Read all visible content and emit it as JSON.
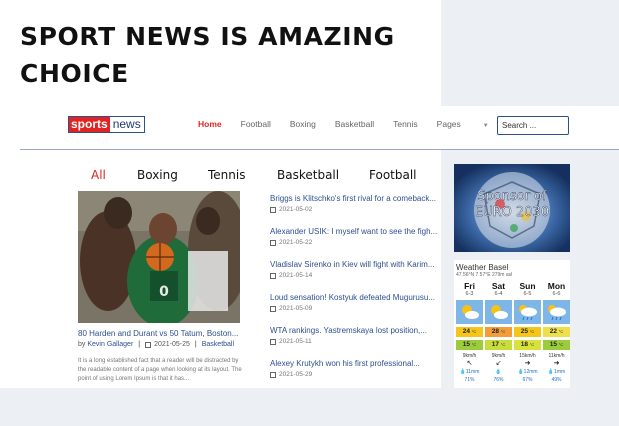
{
  "headline": "SPORT NEWS IS AMAZING CHOICE",
  "logo": {
    "part1": "sports",
    "part2": "news"
  },
  "nav": [
    {
      "label": "Home",
      "active": true
    },
    {
      "label": "Football"
    },
    {
      "label": "Boxing"
    },
    {
      "label": "Basketball"
    },
    {
      "label": "Tennis"
    },
    {
      "label": "Pages"
    }
  ],
  "search": {
    "placeholder": "Search ..."
  },
  "tabs": [
    "All",
    "Boxing",
    "Tennis",
    "Basketball",
    "Football"
  ],
  "feature": {
    "title": "80 Harden and Durant vs 50 Tatum, Boston...",
    "by": "by",
    "author": "Kevin Gallager",
    "date": "2021-05-25",
    "category": "Basketball",
    "excerpt": "It is a long established fact that a reader will be distracted by the readable content of a page when looking at its layout. The point of using Lorem Ipsum is that it has..."
  },
  "news": [
    {
      "title": "Briggs is Klitschko's first rival for a comeback...",
      "date": "2021-05-02"
    },
    {
      "title": "Alexander USIK: I myself want to see the figh...",
      "date": "2021-05-22"
    },
    {
      "title": "Vladislav Sirenko in Kiev will fight with Karim...",
      "date": "2021-05-14"
    },
    {
      "title": "Loud sensation! Kostyuk defeated Mugurusu...",
      "date": "2021-05-09"
    },
    {
      "title": "WTA rankings. Yastremskaya lost position,...",
      "date": "2021-05-11"
    },
    {
      "title": "Alexey Krutykh won his first professional...",
      "date": "2021-05-29"
    }
  ],
  "sponsor": {
    "line1": "Sponsor of",
    "line2": "EURO 2030"
  },
  "weather": {
    "title": "Weather Basel",
    "coords": "47.56°N 7.57°E 279m asl",
    "days": [
      {
        "day": "Fri",
        "date": "6-3",
        "icon": "sun-cloud-icon",
        "high": "24",
        "low": "15",
        "high_color": "#f5c518",
        "low_color": "#9ccc3c",
        "wind": "9",
        "rain": "11",
        "extra": "71",
        "arrow": "↖"
      },
      {
        "day": "Sat",
        "date": "6-4",
        "icon": "sun-cloud-icon",
        "high": "28",
        "low": "17",
        "high_color": "#f39c3a",
        "low_color": "#c8dd3c",
        "wind": "9",
        "rain": "",
        "extra": "76",
        "arrow": "↙"
      },
      {
        "day": "Sun",
        "date": "6-5",
        "icon": "rain-cloud-icon",
        "high": "25",
        "low": "18",
        "high_color": "#f5c518",
        "low_color": "#d8e23c",
        "wind": "15",
        "rain": "12",
        "extra": "67",
        "arrow": "➜"
      },
      {
        "day": "Mon",
        "date": "6-6",
        "icon": "rain-cloud-icon",
        "high": "22",
        "low": "15",
        "high_color": "#eee04a",
        "low_color": "#9ccc3c",
        "wind": "11",
        "rain": "1",
        "extra": "49",
        "arrow": "➜"
      }
    ],
    "units": {
      "temp": "°C",
      "wind": "km/h",
      "rain": "mm"
    }
  }
}
